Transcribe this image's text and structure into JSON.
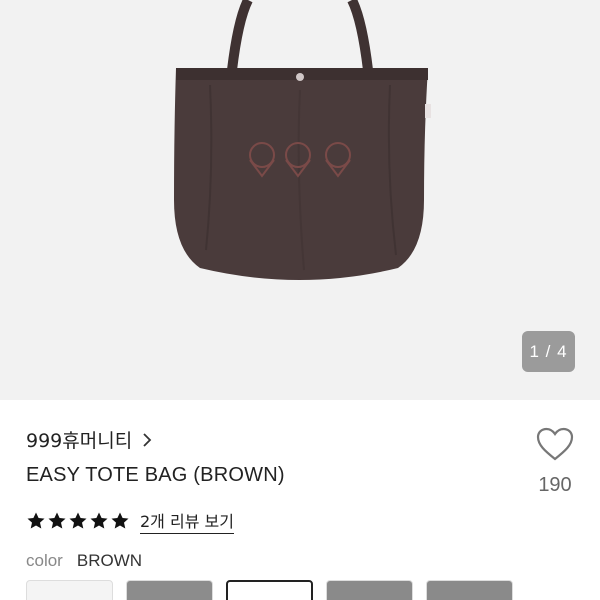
{
  "gallery": {
    "counter": "1 / 4"
  },
  "product": {
    "brand": "999휴머니티",
    "title": "EASY TOTE BAG (BROWN)",
    "rating_stars": 5,
    "review_link": "2개 리뷰 보기",
    "like_count": "190"
  },
  "color": {
    "label": "color",
    "value": "BROWN"
  },
  "swatches": [
    {
      "fill": "#f4f4f4",
      "selected": false
    },
    {
      "fill": "#8c8c8c",
      "selected": false
    },
    {
      "fill": "#ffffff",
      "selected": true
    },
    {
      "fill": "#8a8a8a",
      "selected": false
    },
    {
      "fill": "#8a8a8a",
      "selected": false
    }
  ],
  "colors": {
    "bag": "#4a3a3a",
    "star": "#111111"
  }
}
